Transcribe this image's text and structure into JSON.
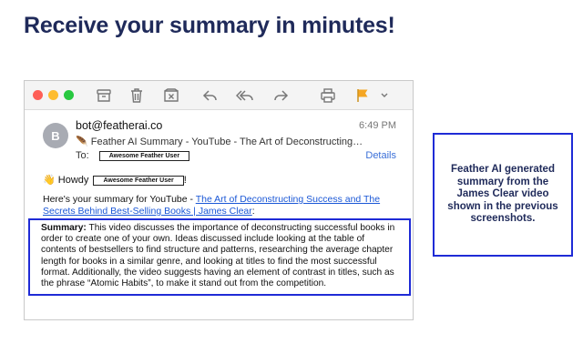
{
  "headline": "Receive your summary in minutes!",
  "window": {
    "toolbar_icons": [
      "archive-icon",
      "trash-icon",
      "junk-icon",
      "reply-icon",
      "reply-all-icon",
      "forward-icon",
      "print-icon",
      "flag-icon",
      "chevron-down-icon"
    ],
    "flag_color": "#f5a623"
  },
  "email": {
    "avatar_letter": "B",
    "sender": "bot@featherai.co",
    "time": "6:49 PM",
    "subject_icon": "feather-icon",
    "subject": "Feather AI Summary - YouTube - The Art of Deconstructing…",
    "to_label": "To:",
    "recipient": "Awesome Feather User",
    "details_label": "Details",
    "greeting": "Howdy",
    "greeting_name": "Awesome Feather User",
    "greeting_end": "!",
    "intro_prefix": "Here's your summary for YouTube - ",
    "intro_link": "The Art of Deconstructing Success and The Secrets Behind Best-Selling Books | James Clear",
    "intro_suffix": ":",
    "summary_label": "Summary:",
    "summary_text": "This video discusses the importance of deconstructing successful books in order to create one of your own. Ideas discussed include looking at the table of contents of bestsellers to find structure and patterns, researching the average chapter length for books in a similar genre, and looking at titles to find the most successful format. Additionally, the video suggests having an element of contrast in titles, such as the phrase “Atomic Habits”, to make it stand out from the competition."
  },
  "callout": "Feather AI generated summary from the James Clear video shown in the previous screenshots.",
  "colors": {
    "accent": "#1f2bd6",
    "headline": "#1f2a5a",
    "link": "#1a57d6"
  }
}
